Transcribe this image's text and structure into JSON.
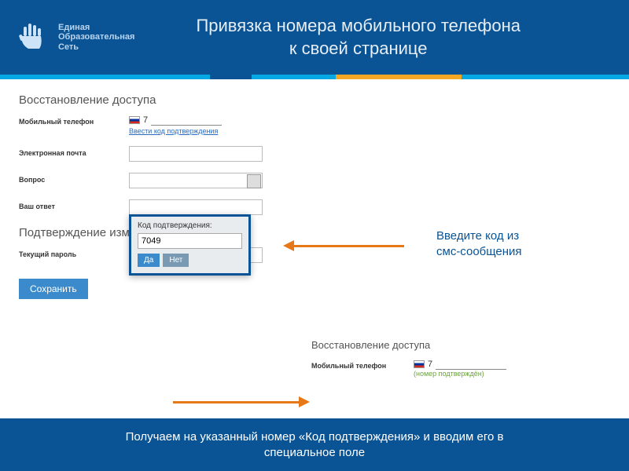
{
  "header": {
    "brand_line1": "Единая",
    "brand_line2": "Образовательная",
    "brand_line3": "Сеть",
    "title_line1": "Привязка номера мобильного телефона",
    "title_line2": "к своей странице"
  },
  "form": {
    "section1_title": "Восстановление доступа",
    "phone_label": "Мобильный телефон",
    "phone_prefix": "7",
    "enter_code_link": "Ввести код подтверждения",
    "email_label": "Электронная почта",
    "question_label": "Вопрос",
    "answer_label": "Ваш ответ",
    "section2_title": "Подтверждение изменений",
    "password_label": "Текущий пароль",
    "password_value": "••••••••",
    "save_label": "Сохранить"
  },
  "popup": {
    "label": "Код подтверждения:",
    "value": "7049",
    "yes": "Да",
    "no": "Нет"
  },
  "callout_line1": "Введите код из",
  "callout_line2": "смс-сообщения",
  "mini": {
    "title": "Восстановление доступа",
    "phone_label": "Мобильный телефон",
    "phone_prefix": "7",
    "confirmed": "(номер подтверждён)"
  },
  "footer_line1": "Получаем на указанный номер «Код подтверждения» и вводим его в",
  "footer_line2": "специальное поле"
}
